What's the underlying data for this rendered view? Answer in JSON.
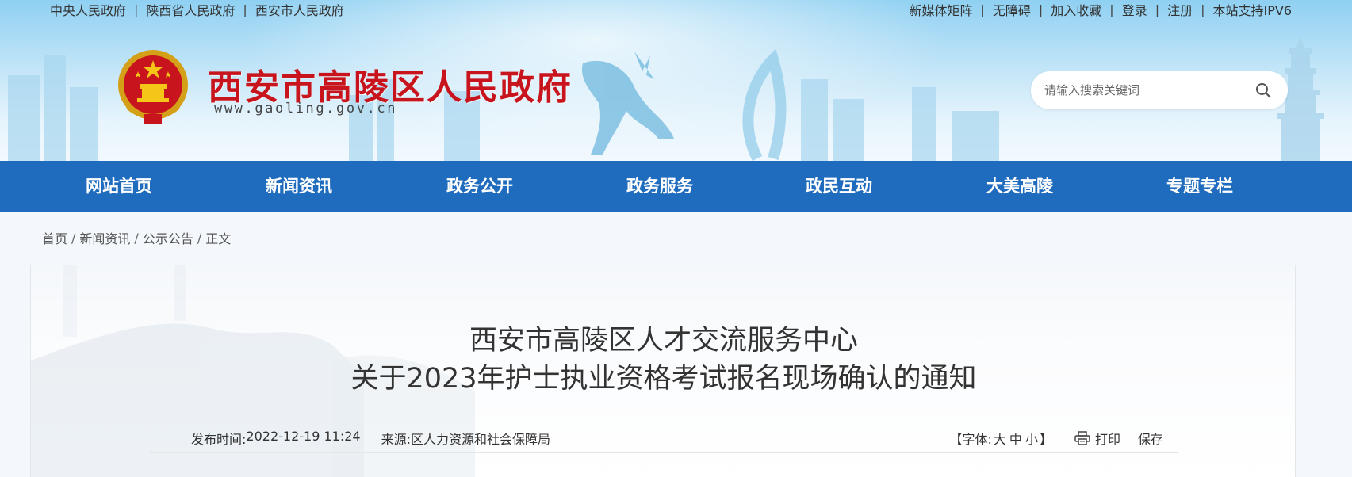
{
  "top_links_left": [
    "中央人民政府",
    "陕西省人民政府",
    "西安市人民政府"
  ],
  "top_links_right": [
    "新媒体矩阵",
    "无障碍",
    "加入收藏",
    "登录",
    "注册",
    "本站支持IPV6"
  ],
  "top_separator": "|",
  "site": {
    "title": "西安市高陵区人民政府",
    "domain": "www.gaoling.gov.cn"
  },
  "search": {
    "placeholder": "请输入搜索关键词",
    "icon": "search-icon"
  },
  "nav": [
    "网站首页",
    "新闻资讯",
    "政务公开",
    "政务服务",
    "政民互动",
    "大美高陵",
    "专题专栏"
  ],
  "breadcrumb": {
    "items": [
      "首页",
      "新闻资讯",
      "公示公告",
      "正文"
    ],
    "separator": "/"
  },
  "article": {
    "title_line_1": "西安市高陵区人才交流服务中心",
    "title_line_2": "关于2023年护士执业资格考试报名现场确认的通知",
    "publish_label": "发布时间:",
    "publish_time": "2022-12-19 11:24",
    "source_label": "来源:",
    "source": "区人力资源和社会保障局",
    "font_open": "【字体:",
    "font_large": "大",
    "font_medium": "中",
    "font_small": "小",
    "font_close": "】",
    "print_label": "打印",
    "print_icon": "printer-icon",
    "save_label": "保存"
  },
  "colors": {
    "nav_bg": "#1f6bbd",
    "title_red": "#c8151d",
    "text": "#333333"
  }
}
